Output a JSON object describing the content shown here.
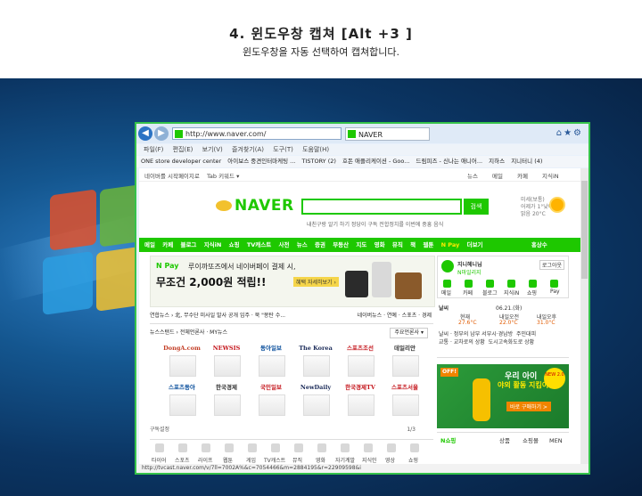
{
  "header": {
    "title": "4. 윈도우창 캡쳐 [Alt +3 ]",
    "subtitle": "윈도우창을 자동 선택하여 캡쳐합니다."
  },
  "browser": {
    "address": "http://www.naver.com/",
    "tab_title": "NAVER",
    "menu": [
      "파일(F)",
      "편집(E)",
      "보기(V)",
      "즐겨찾기(A)",
      "도구(T)",
      "도움말(H)"
    ],
    "favorites": [
      "ONE store developer center",
      "아이보스 중견인터마케팅 ...",
      "TISTORY (2)",
      "호돈 애플리케이션 - Goo...",
      "드림피즈 - 신나는 애니어...",
      "지하스",
      "지니터니 (4)"
    ],
    "status_url": "http://tvcast.naver.com/v/7ll=7002A%&c=7054466&m=2884195&r=22909598&i"
  },
  "naver": {
    "toolbar_left": "네이버를 시작페이지로",
    "toolbar_mid": "Tab 키워드 ▾",
    "top_links": [
      "뉴스",
      "메일",
      "카페",
      "지식iN"
    ],
    "logo": "NAVER",
    "search_button": "검색",
    "keywords": "내친구랑 알기 하기   정당이 구독   전합정치를 이번에 중흥 음식",
    "weather_side": "미세(보통)\n어제가 1°낮아요\n맑음 20°C",
    "gnb": [
      "메일",
      "카페",
      "블로그",
      "지식iN",
      "쇼핑",
      "TV캐스트",
      "사전",
      "뉴스",
      "증권",
      "부동산",
      "지도",
      "영화",
      "뮤직",
      "책",
      "웹툰"
    ],
    "gnb_pay": "N Pay",
    "gnb_more": "더보기",
    "gnb_right": "홍상수",
    "banner": {
      "tag": "N Pay",
      "line1": "루이까또즈에서 네이버페이 결제 시,",
      "line2": "무조건 2,000원 적립!!",
      "button": "혜택 자세히보기 ›"
    },
    "news_headline": "연합뉴스 › 北, 무수단 미사일 발사 공개 임주 · 북 \"몽탄 수...",
    "news_tabs_right": "네이버뉴스 · 연예 · 스포츠 · 경제",
    "newsstand_tab": "뉴스스탠드 › 전체언론사 · MY뉴스",
    "newsstand_sort": "주요언론사 ▾",
    "papers": [
      "DongA.com",
      "NEWSIS",
      "동아일보",
      "The Korea Herald",
      "스포츠조선",
      "데일리안",
      "스포츠동아",
      "한국경제",
      "국민일보",
      "NewDaily",
      "한국경제TV",
      "스포츠서울"
    ],
    "newsstand_footer": "구독설정",
    "newsstand_page": "1/3",
    "bottom_items": [
      "타이어",
      "스포츠",
      "라이프",
      "웹툰",
      "게임",
      "TV캐스트",
      "뮤직",
      "영화",
      "자기계발",
      "지식인",
      "영상",
      "쇼핑"
    ],
    "login": {
      "name": "지니헤니님",
      "badge": "N마일리지",
      "logout": "로그아웃",
      "links": [
        "메일",
        "카페",
        "블로그",
        "지식iN",
        "쇼핑",
        "Pay"
      ]
    },
    "weather": {
      "label": "날씨",
      "date": "06.21.(화)",
      "city1": "현재",
      "temp1": "27.6°C",
      "city2": "내일오전",
      "temp2": "22.0°C",
      "city3": "내일오후",
      "temp3": "31.0°C",
      "alerts": "날씨 · 정부의 남부 서부시·경남방  주민대피\n교통 · 교차로의 상황  도시고속화도로 상황"
    },
    "ad": {
      "tag": "OFF!",
      "line1": "우리 아이",
      "line2": "야외 활동 지킴이",
      "button": "바로 구매하기 >",
      "badge": "NEW 2.0"
    },
    "shopping": {
      "label": "N쇼핑",
      "tabs": [
        "상품",
        "쇼핑몰",
        "MEN"
      ]
    }
  }
}
